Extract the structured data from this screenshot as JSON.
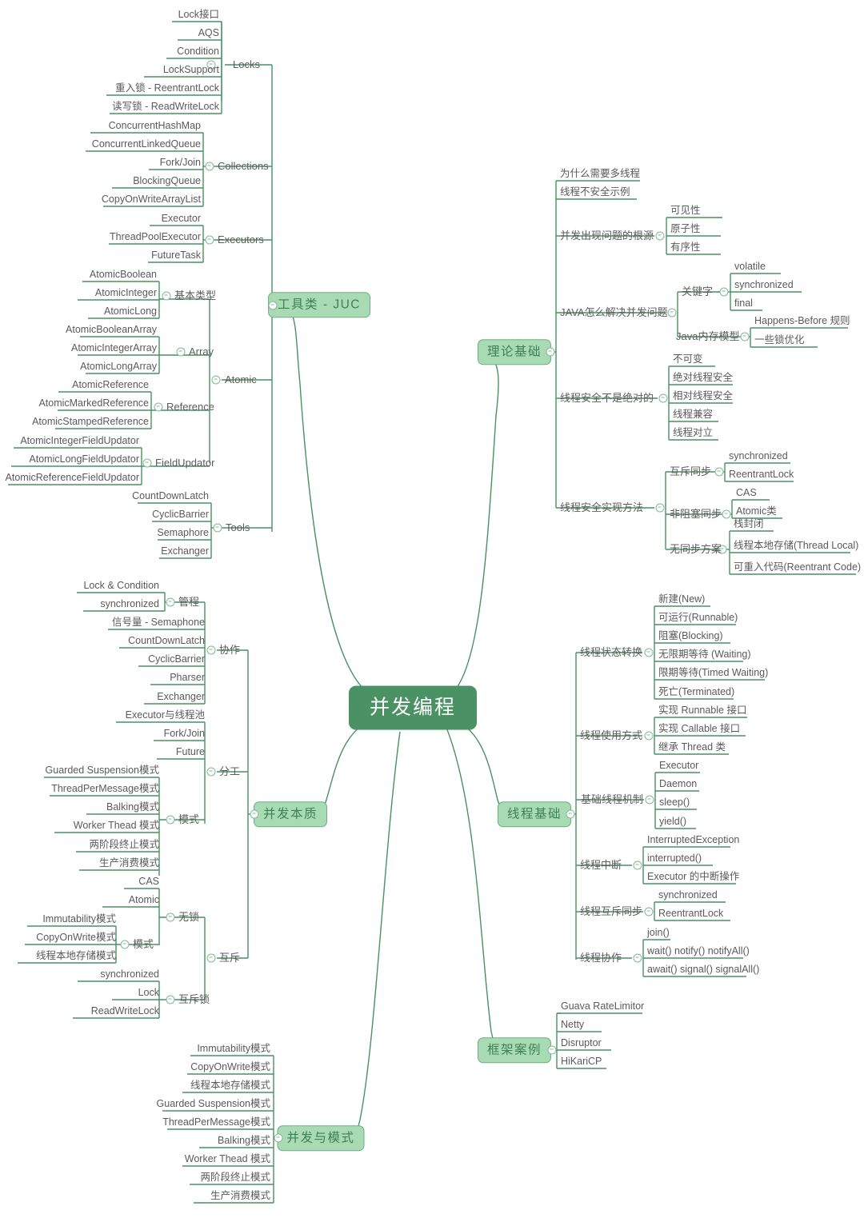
{
  "mindmap": {
    "root": {
      "label": "并发编程"
    },
    "branches": [
      {
        "id": "juc",
        "label": "工具类 - JUC",
        "groups": [
          {
            "label": "Locks",
            "items": [
              "Lock接口",
              "AQS",
              "Condition",
              "LockSupport",
              "重入锁 - ReentrantLock",
              "读写锁 - ReadWriteLock"
            ]
          },
          {
            "label": "Collections",
            "items": [
              "ConcurrentHashMap",
              "ConcurrentLinkedQueue",
              "Fork/Join",
              "BlockingQueue",
              "CopyOnWriteArrayList"
            ]
          },
          {
            "label": "Executors",
            "items": [
              "Executor",
              "ThreadPoolExecutor",
              "FutureTask"
            ]
          },
          {
            "label": "Atomic",
            "subgroups": [
              {
                "label": "基本类型",
                "items": [
                  "AtomicBoolean",
                  "AtomicInteger",
                  "AtomicLong"
                ]
              },
              {
                "label": "Array",
                "items": [
                  "AtomicBooleanArray",
                  "AtomicIntegerArray",
                  "AtomicLongArray"
                ]
              },
              {
                "label": "Reference",
                "items": [
                  "AtomicReference",
                  "AtomicMarkedReference",
                  "AtomicStampedReference"
                ]
              },
              {
                "label": "FieldUpdator",
                "items": [
                  "AtomicIntegerFieldUpdator",
                  "AtomicLongFieldUpdator",
                  "AtomicReferenceFieldUpdator"
                ]
              }
            ]
          },
          {
            "label": "Tools",
            "items": [
              "CountDownLatch",
              "CyclicBarrier",
              "Semaphore",
              "Exchanger"
            ]
          }
        ]
      },
      {
        "id": "theory",
        "label": "理论基础",
        "groups": [
          {
            "label": "为什么需要多线程",
            "items": []
          },
          {
            "label": "线程不安全示例",
            "items": []
          },
          {
            "label": "并发出现问题的根源",
            "items": [
              "可见性",
              "原子性",
              "有序性"
            ]
          },
          {
            "label": "JAVA怎么解决并发问题",
            "subgroups": [
              {
                "label": "关键字",
                "items": [
                  "volatile",
                  "synchronized",
                  "final"
                ]
              },
              {
                "label": "Java内存模型",
                "items": [
                  "Happens-Before 规则",
                  "一些锁优化"
                ]
              }
            ]
          },
          {
            "label": "线程安全不是绝对的",
            "items": [
              "不可变",
              "绝对线程安全",
              "相对线程安全",
              "线程兼容",
              "线程对立"
            ]
          },
          {
            "label": "线程安全实现方法",
            "subgroups": [
              {
                "label": "互斥同步",
                "items": [
                  "synchronized",
                  "ReentrantLock"
                ]
              },
              {
                "label": "非阻塞同步",
                "items": [
                  "CAS",
                  "Atomic类"
                ]
              },
              {
                "label": "无同步方案",
                "items": [
                  "栈封闭",
                  "线程本地存储(Thread Local)",
                  "可重入代码(Reentrant Code)"
                ]
              }
            ]
          }
        ]
      },
      {
        "id": "threadbasics",
        "label": "线程基础",
        "groups": [
          {
            "label": "线程状态转换",
            "items": [
              "新建(New)",
              "可运行(Runnable)",
              "阻塞(Blocking)",
              "无限期等待 (Waiting)",
              "限期等待(Timed Waiting)",
              "死亡(Terminated)"
            ]
          },
          {
            "label": "线程使用方式",
            "items": [
              "实现 Runnable 接口",
              "实现 Callable 接口",
              "继承 Thread 类"
            ]
          },
          {
            "label": "基础线程机制",
            "items": [
              "Executor",
              "Daemon",
              "sleep()",
              "yield()"
            ]
          },
          {
            "label": "线程中断",
            "items": [
              "InterruptedException",
              "interrupted()",
              "Executor 的中断操作"
            ]
          },
          {
            "label": "线程互斥同步",
            "items": [
              "synchronized",
              "ReentrantLock"
            ]
          },
          {
            "label": "线程协作",
            "items": [
              "join()",
              "wait() notify() notifyAll()",
              "await() signal() signalAll()"
            ]
          }
        ]
      },
      {
        "id": "essence",
        "label": "并发本质",
        "groups": [
          {
            "label": "协作",
            "subgroups": [
              {
                "label": "管程",
                "items": [
                  "Lock & Condition",
                  "synchronized"
                ]
              },
              {
                "label": "",
                "items": [
                  "信号量 - Semaphone",
                  "CountDownLatch",
                  "CyclicBarrier",
                  "Pharser",
                  "Exchanger"
                ]
              }
            ]
          },
          {
            "label": "分工",
            "subgroups": [
              {
                "label": "",
                "items": [
                  "Executor与线程池",
                  "Fork/Join",
                  "Future"
                ]
              },
              {
                "label": "模式",
                "items": [
                  "Guarded Suspension模式",
                  "ThreadPerMessage模式",
                  "Balking模式",
                  "Worker Thead 模式",
                  "两阶段终止模式",
                  "生产消费模式"
                ]
              }
            ]
          },
          {
            "label": "互斥",
            "subgroups": [
              {
                "label": "无锁",
                "items": [
                  "CAS",
                  "Atomic"
                ]
              },
              {
                "label": "模式",
                "items": [
                  "Immutability模式",
                  "CopyOnWrite模式",
                  "线程本地存储模式"
                ]
              },
              {
                "label": "互斥锁",
                "items": [
                  "synchronized",
                  "Lock",
                  "ReadWriteLock"
                ]
              }
            ]
          }
        ]
      },
      {
        "id": "frameworks",
        "label": "框架案例",
        "groups": [
          {
            "label": "",
            "items": [
              "Guava RateLimitor",
              "Netty",
              "Disruptor",
              "HiKariCP"
            ]
          }
        ]
      },
      {
        "id": "patterns",
        "label": "并发与模式",
        "groups": [
          {
            "label": "",
            "items": [
              "Immutability模式",
              "CopyOnWrite模式",
              "线程本地存储模式",
              "Guarded Suspension模式",
              "ThreadPerMessage模式",
              "Balking模式",
              "Worker Thead 模式",
              "两阶段终止模式",
              "生产消费模式"
            ]
          }
        ]
      }
    ]
  },
  "labels": {
    "l_lock_jiekou": "Lock接口",
    "l_aqs": "AQS",
    "l_condition": "Condition",
    "l_locksupport": "LockSupport",
    "l_reentrant": "重入锁 - ReentrantLock",
    "l_readwrite": "读写锁 - ReadWriteLock",
    "g_locks": "Locks",
    "l_chm": "ConcurrentHashMap",
    "l_clq": "ConcurrentLinkedQueue",
    "l_forkjoin": "Fork/Join",
    "l_bq": "BlockingQueue",
    "l_cowal": "CopyOnWriteArrayList",
    "g_collections": "Collections",
    "l_executor": "Executor",
    "l_tpe": "ThreadPoolExecutor",
    "l_futuretask": "FutureTask",
    "g_executors": "Executors",
    "l_ab": "AtomicBoolean",
    "l_ai": "AtomicInteger",
    "l_al": "AtomicLong",
    "g_basic": "基本类型",
    "l_aba": "AtomicBooleanArray",
    "l_aia": "AtomicIntegerArray",
    "l_ala": "AtomicLongArray",
    "g_array": "Array",
    "l_ar": "AtomicReference",
    "l_amr": "AtomicMarkedReference",
    "l_asr": "AtomicStampedReference",
    "g_reference": "Reference",
    "l_aifu": "AtomicIntegerFieldUpdator",
    "l_alfu": "AtomicLongFieldUpdator",
    "l_arfu": "AtomicReferenceFieldUpdator",
    "g_fieldupdator": "FieldUpdator",
    "g_atomic": "Atomic",
    "l_cdl": "CountDownLatch",
    "l_cb": "CyclicBarrier",
    "l_sem": "Semaphore",
    "l_exch": "Exchanger",
    "g_tools": "Tools",
    "b_juc": "工具类 - JUC",
    "t_why": "为什么需要多线程",
    "t_unsafe": "线程不安全示例",
    "t_root": "并发出现问题的根源",
    "t_visible": "可见性",
    "t_atomic": "原子性",
    "t_order": "有序性",
    "t_javasolve": "JAVA怎么解决并发问题",
    "t_keyword": "关键字",
    "t_volatile": "volatile",
    "t_sync": "synchronized",
    "t_final": "final",
    "t_jmm": "Java内存模型",
    "t_hb": "Happens-Before 规则",
    "t_lockopt": "一些锁优化",
    "t_notabs": "线程安全不是绝对的",
    "t_immutable": "不可变",
    "t_abs": "绝对线程安全",
    "t_rel": "相对线程安全",
    "t_compat": "线程兼容",
    "t_oppose": "线程对立",
    "t_impl": "线程安全实现方法",
    "t_mutex": "互斥同步",
    "t_sync2": "synchronized",
    "t_rl": "ReentrantLock",
    "t_nonblock": "非阻塞同步",
    "t_cas": "CAS",
    "t_atomiccls": "Atomic类",
    "t_nosync": "无同步方案",
    "t_stack": "栈封闭",
    "t_tls": "线程本地存储(Thread Local)",
    "t_reentrantcode": "可重入代码(Reentrant Code)",
    "b_theory": "理论基础",
    "h_state": "线程状态转换",
    "h_new": "新建(New)",
    "h_runnable": "可运行(Runnable)",
    "h_blocking": "阻塞(Blocking)",
    "h_waiting": "无限期等待 (Waiting)",
    "h_timed": "限期等待(Timed Waiting)",
    "h_term": "死亡(Terminated)",
    "h_usage": "线程使用方式",
    "h_irunnable": "实现 Runnable 接口",
    "h_icallable": "实现 Callable 接口",
    "h_extthread": "继承 Thread 类",
    "h_mech": "基础线程机制",
    "h_executor": "Executor",
    "h_daemon": "Daemon",
    "h_sleep": "sleep()",
    "h_yield": "yield()",
    "h_interrupt": "线程中断",
    "h_ie": "InterruptedException",
    "h_interrupted": "interrupted()",
    "h_execint": "Executor 的中断操作",
    "h_mutexsync": "线程互斥同步",
    "h_sync": "synchronized",
    "h_rl": "ReentrantLock",
    "h_coop": "线程协作",
    "h_join": "join()",
    "h_wait": "wait() notify() notifyAll()",
    "h_await": "await() signal() signalAll()",
    "b_thread": "线程基础",
    "e_lockcond": "Lock & Condition",
    "e_sync": "synchronized",
    "e_guancheng": "管程",
    "e_semaphone": "信号量 - Semaphone",
    "e_cdl": "CountDownLatch",
    "e_cb": "CyclicBarrier",
    "e_pharser": "Pharser",
    "e_exchanger": "Exchanger",
    "e_coop": "协作",
    "e_execpool": "Executor与线程池",
    "e_forkjoin": "Fork/Join",
    "e_future": "Future",
    "e_division": "分工",
    "e_gs": "Guarded Suspension模式",
    "e_tpm": "ThreadPerMessage模式",
    "e_balking": "Balking模式",
    "e_wt": "Worker Thead 模式",
    "e_twophase": "两阶段终止模式",
    "e_prodcons": "生产消费模式",
    "e_pattern1": "模式",
    "e_cas": "CAS",
    "e_atomic": "Atomic",
    "e_nolock": "无锁",
    "e_immut": "Immutability模式",
    "e_cow": "CopyOnWrite模式",
    "e_tls": "线程本地存储模式",
    "e_pattern2": "模式",
    "e_sync2": "synchronized",
    "e_lock": "Lock",
    "e_rwl": "ReadWriteLock",
    "e_mutexlock": "互斥锁",
    "e_mutex": "互斥",
    "b_essence": "并发本质",
    "f_guava": "Guava RateLimitor",
    "f_netty": "Netty",
    "f_disruptor": "Disruptor",
    "f_hikari": "HiKariCP",
    "b_frameworks": "框架案例",
    "p_immut": "Immutability模式",
    "p_cow": "CopyOnWrite模式",
    "p_tls": "线程本地存储模式",
    "p_gs": "Guarded Suspension模式",
    "p_tpm": "ThreadPerMessage模式",
    "p_balking": "Balking模式",
    "p_wt": "Worker Thead 模式",
    "p_twophase": "两阶段终止模式",
    "p_prodcons": "生产消费模式",
    "b_patterns": "并发与模式",
    "root": "并发编程"
  },
  "colors": {
    "line": "#4a9163",
    "root_bg": "#4a9163",
    "root_text": "#ffffff",
    "lvl1_bg": "#a8dbb4",
    "lvl1_border": "#6fae81",
    "lvl1_text": "#3f7f55",
    "leaf_text": "#5a5a5a",
    "background": "#ffffff"
  }
}
